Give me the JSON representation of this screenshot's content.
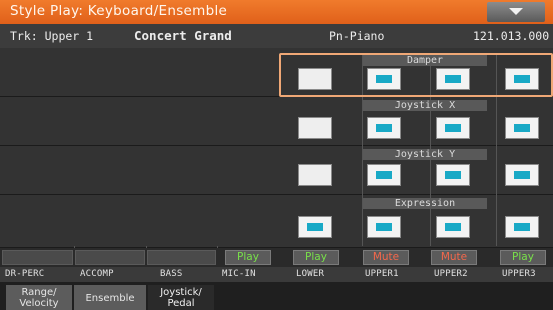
{
  "title": "Style Play: Keyboard/Ensemble",
  "info": {
    "track": "Trk: Upper 1",
    "sound": "Concert Grand",
    "category": "Pn-Piano",
    "program": "121.013.000"
  },
  "sections": [
    {
      "name": "Damper",
      "cells": [
        "off",
        "on",
        "on",
        "on"
      ]
    },
    {
      "name": "Joystick X",
      "cells": [
        "off",
        "on",
        "on",
        "on"
      ]
    },
    {
      "name": "Joystick Y",
      "cells": [
        "off",
        "on",
        "on",
        "on"
      ]
    },
    {
      "name": "Expression",
      "cells": [
        "on",
        "on",
        "on",
        "on"
      ]
    }
  ],
  "play_mute": [
    "Play",
    "Play",
    "Mute",
    "Mute",
    "Play"
  ],
  "tracks": [
    "DR-PERC",
    "ACCOMP",
    "BASS",
    "MIC-IN",
    "LOWER",
    "UPPER1",
    "UPPER2",
    "UPPER3"
  ],
  "tabs": [
    {
      "label": "Range/\nVelocity",
      "state": "inactive"
    },
    {
      "label": "Ensemble",
      "state": "inactive"
    },
    {
      "label": "Joystick/\nPedal",
      "state": "active"
    }
  ],
  "colors": {
    "title_bar": "#e96a22",
    "active_cell": "#19a9c6",
    "play": "#79e04a",
    "mute": "#f3684c",
    "highlight": "#f0a876"
  }
}
